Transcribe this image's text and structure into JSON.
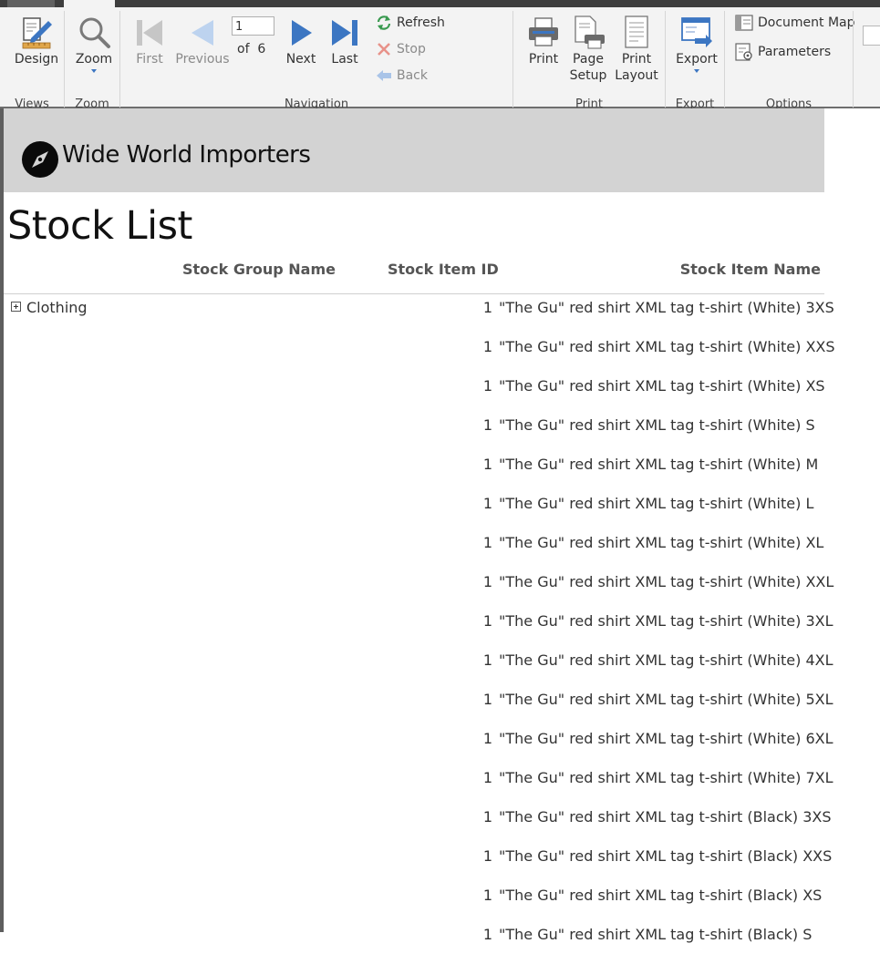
{
  "ribbon": {
    "views": {
      "design_label": "Design",
      "group_label": "Views"
    },
    "zoom": {
      "zoom_label": "Zoom",
      "group_label": "Zoom"
    },
    "navigation": {
      "first_label": "First",
      "previous_label": "Previous",
      "current_page": "1",
      "of_label": "of",
      "total_pages": "6",
      "next_label": "Next",
      "last_label": "Last",
      "refresh_label": "Refresh",
      "stop_label": "Stop",
      "back_label": "Back",
      "group_label": "Navigation"
    },
    "print": {
      "print_label": "Print",
      "page_setup_label_1": "Page",
      "page_setup_label_2": "Setup",
      "print_layout_label_1": "Print",
      "print_layout_label_2": "Layout",
      "group_label": "Print"
    },
    "export": {
      "export_label": "Export",
      "group_label": "Export"
    },
    "options": {
      "document_map_label": "Document Map",
      "parameters_label": "Parameters",
      "group_label": "Options"
    }
  },
  "report": {
    "company": "Wide World Importers",
    "title": "Stock List",
    "columns": {
      "group": "Stock Group Name",
      "id": "Stock Item ID",
      "name": "Stock Item Name"
    },
    "group_name": "Clothing",
    "rows": [
      {
        "id": "1",
        "name": "\"The Gu\" red shirt XML tag t-shirt (White) 3XS"
      },
      {
        "id": "1",
        "name": "\"The Gu\" red shirt XML tag t-shirt (White) XXS"
      },
      {
        "id": "1",
        "name": "\"The Gu\" red shirt XML tag t-shirt (White) XS"
      },
      {
        "id": "1",
        "name": "\"The Gu\" red shirt XML tag t-shirt (White) S"
      },
      {
        "id": "1",
        "name": "\"The Gu\" red shirt XML tag t-shirt (White) M"
      },
      {
        "id": "1",
        "name": "\"The Gu\" red shirt XML tag t-shirt (White) L"
      },
      {
        "id": "1",
        "name": "\"The Gu\" red shirt XML tag t-shirt (White) XL"
      },
      {
        "id": "1",
        "name": "\"The Gu\" red shirt XML tag t-shirt (White) XXL"
      },
      {
        "id": "1",
        "name": "\"The Gu\" red shirt XML tag t-shirt (White) 3XL"
      },
      {
        "id": "1",
        "name": "\"The Gu\" red shirt XML tag t-shirt (White) 4XL"
      },
      {
        "id": "1",
        "name": "\"The Gu\" red shirt XML tag t-shirt (White) 5XL"
      },
      {
        "id": "1",
        "name": "\"The Gu\" red shirt XML tag t-shirt (White) 6XL"
      },
      {
        "id": "1",
        "name": "\"The Gu\" red shirt XML tag t-shirt (White) 7XL"
      },
      {
        "id": "1",
        "name": "\"The Gu\" red shirt XML tag t-shirt (Black) 3XS"
      },
      {
        "id": "1",
        "name": "\"The Gu\" red shirt XML tag t-shirt (Black) XXS"
      },
      {
        "id": "1",
        "name": "\"The Gu\" red shirt XML tag t-shirt (Black) XS"
      },
      {
        "id": "1",
        "name": "\"The Gu\" red shirt XML tag t-shirt (Black) S"
      }
    ]
  },
  "colors": {
    "accent": "#3c76c2",
    "banner": "#d3d3d3",
    "ribbon": "#f3f3f3"
  }
}
